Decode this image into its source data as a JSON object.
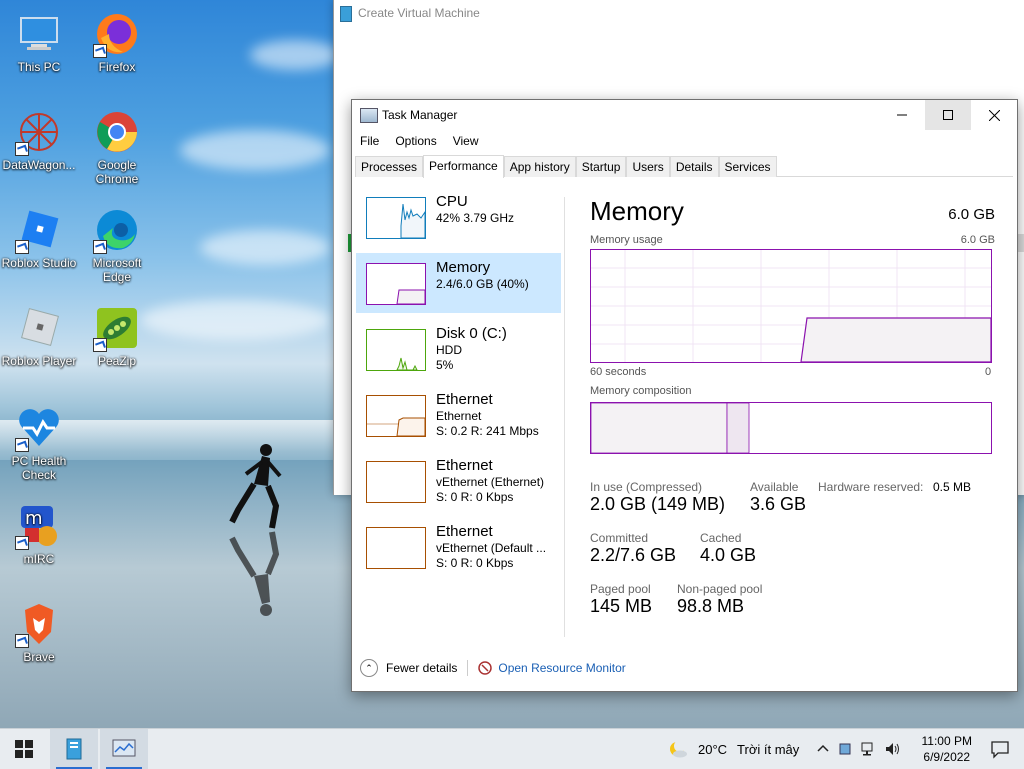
{
  "desktop_icons": [
    {
      "label": "This PC",
      "icon": "this-pc-icon"
    },
    {
      "label": "Firefox",
      "icon": "firefox-icon"
    },
    {
      "label": "DataWagon...",
      "icon": "datawagon-icon"
    },
    {
      "label": "Google Chrome",
      "icon": "chrome-icon"
    },
    {
      "label": "Roblox Studio",
      "icon": "roblox-studio-icon"
    },
    {
      "label": "Microsoft Edge",
      "icon": "edge-icon"
    },
    {
      "label": "Roblox Player",
      "icon": "roblox-player-icon"
    },
    {
      "label": "PeaZip",
      "icon": "peazip-icon"
    },
    {
      "label": "PC Health Check",
      "icon": "pc-health-icon"
    },
    {
      "label": "mIRC",
      "icon": "mirc-icon"
    },
    {
      "label": "Brave",
      "icon": "brave-icon"
    }
  ],
  "background_window": {
    "title": "Create Virtual Machine"
  },
  "task_manager": {
    "title": "Task Manager",
    "menu": [
      "File",
      "Options",
      "View"
    ],
    "tabs": [
      "Processes",
      "Performance",
      "App history",
      "Startup",
      "Users",
      "Details",
      "Services"
    ],
    "active_tab": "Performance",
    "resources": [
      {
        "name": "CPU",
        "line1": "42%  3.79 GHz",
        "line2": ""
      },
      {
        "name": "Memory",
        "line1": "2.4/6.0 GB (40%)",
        "line2": ""
      },
      {
        "name": "Disk 0 (C:)",
        "line1": "HDD",
        "line2": "5%"
      },
      {
        "name": "Ethernet",
        "line1": "Ethernet",
        "line2": "S: 0.2  R: 241 Mbps"
      },
      {
        "name": "Ethernet",
        "line1": "vEthernet (Ethernet)",
        "line2": "S: 0  R: 0 Kbps"
      },
      {
        "name": "Ethernet",
        "line1": "vEthernet (Default ...",
        "line2": "S: 0  R: 0 Kbps"
      }
    ],
    "selected_resource": "Memory",
    "memory": {
      "title": "Memory",
      "total": "6.0 GB",
      "usage_label": "Memory usage",
      "usage_max": "6.0 GB",
      "time_left": "60 seconds",
      "time_right": "0",
      "composition_label": "Memory composition",
      "in_use_label": "In use (Compressed)",
      "in_use_value": "2.0 GB (149 MB)",
      "available_label": "Available",
      "available_value": "3.6 GB",
      "hw_reserved_label": "Hardware reserved:",
      "hw_reserved_value": "0.5 MB",
      "committed_label": "Committed",
      "committed_value": "2.2/7.6 GB",
      "cached_label": "Cached",
      "cached_value": "4.0 GB",
      "paged_label": "Paged pool",
      "paged_value": "145 MB",
      "nonpaged_label": "Non-paged pool",
      "nonpaged_value": "98.8 MB"
    },
    "footer": {
      "fewer_details": "Fewer details",
      "open_resource_monitor": "Open Resource Monitor"
    }
  },
  "taskbar": {
    "weather_temp": "20°C",
    "weather_text": "Trời ít mây",
    "time": "11:00 PM",
    "date": "6/9/2022"
  },
  "colors": {
    "memory_accent": "#8b12ae",
    "cpu_accent": "#117dbb",
    "disk_accent": "#4da60c",
    "net_accent": "#a74f01",
    "selected": "#cce8ff"
  }
}
